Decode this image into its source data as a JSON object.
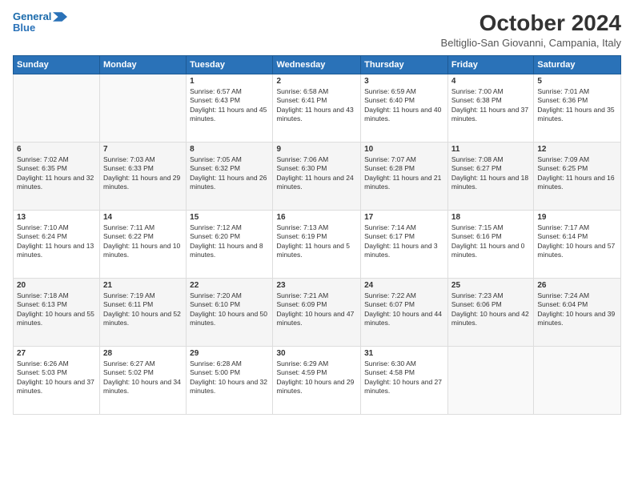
{
  "header": {
    "logo_line1": "General",
    "logo_line2": "Blue",
    "month": "October 2024",
    "location": "Beltiglio-San Giovanni, Campania, Italy"
  },
  "days_of_week": [
    "Sunday",
    "Monday",
    "Tuesday",
    "Wednesday",
    "Thursday",
    "Friday",
    "Saturday"
  ],
  "weeks": [
    [
      {
        "day": "",
        "data": ""
      },
      {
        "day": "",
        "data": ""
      },
      {
        "day": "1",
        "data": "Sunrise: 6:57 AM\nSunset: 6:43 PM\nDaylight: 11 hours and 45 minutes."
      },
      {
        "day": "2",
        "data": "Sunrise: 6:58 AM\nSunset: 6:41 PM\nDaylight: 11 hours and 43 minutes."
      },
      {
        "day": "3",
        "data": "Sunrise: 6:59 AM\nSunset: 6:40 PM\nDaylight: 11 hours and 40 minutes."
      },
      {
        "day": "4",
        "data": "Sunrise: 7:00 AM\nSunset: 6:38 PM\nDaylight: 11 hours and 37 minutes."
      },
      {
        "day": "5",
        "data": "Sunrise: 7:01 AM\nSunset: 6:36 PM\nDaylight: 11 hours and 35 minutes."
      }
    ],
    [
      {
        "day": "6",
        "data": "Sunrise: 7:02 AM\nSunset: 6:35 PM\nDaylight: 11 hours and 32 minutes."
      },
      {
        "day": "7",
        "data": "Sunrise: 7:03 AM\nSunset: 6:33 PM\nDaylight: 11 hours and 29 minutes."
      },
      {
        "day": "8",
        "data": "Sunrise: 7:05 AM\nSunset: 6:32 PM\nDaylight: 11 hours and 26 minutes."
      },
      {
        "day": "9",
        "data": "Sunrise: 7:06 AM\nSunset: 6:30 PM\nDaylight: 11 hours and 24 minutes."
      },
      {
        "day": "10",
        "data": "Sunrise: 7:07 AM\nSunset: 6:28 PM\nDaylight: 11 hours and 21 minutes."
      },
      {
        "day": "11",
        "data": "Sunrise: 7:08 AM\nSunset: 6:27 PM\nDaylight: 11 hours and 18 minutes."
      },
      {
        "day": "12",
        "data": "Sunrise: 7:09 AM\nSunset: 6:25 PM\nDaylight: 11 hours and 16 minutes."
      }
    ],
    [
      {
        "day": "13",
        "data": "Sunrise: 7:10 AM\nSunset: 6:24 PM\nDaylight: 11 hours and 13 minutes."
      },
      {
        "day": "14",
        "data": "Sunrise: 7:11 AM\nSunset: 6:22 PM\nDaylight: 11 hours and 10 minutes."
      },
      {
        "day": "15",
        "data": "Sunrise: 7:12 AM\nSunset: 6:20 PM\nDaylight: 11 hours and 8 minutes."
      },
      {
        "day": "16",
        "data": "Sunrise: 7:13 AM\nSunset: 6:19 PM\nDaylight: 11 hours and 5 minutes."
      },
      {
        "day": "17",
        "data": "Sunrise: 7:14 AM\nSunset: 6:17 PM\nDaylight: 11 hours and 3 minutes."
      },
      {
        "day": "18",
        "data": "Sunrise: 7:15 AM\nSunset: 6:16 PM\nDaylight: 11 hours and 0 minutes."
      },
      {
        "day": "19",
        "data": "Sunrise: 7:17 AM\nSunset: 6:14 PM\nDaylight: 10 hours and 57 minutes."
      }
    ],
    [
      {
        "day": "20",
        "data": "Sunrise: 7:18 AM\nSunset: 6:13 PM\nDaylight: 10 hours and 55 minutes."
      },
      {
        "day": "21",
        "data": "Sunrise: 7:19 AM\nSunset: 6:11 PM\nDaylight: 10 hours and 52 minutes."
      },
      {
        "day": "22",
        "data": "Sunrise: 7:20 AM\nSunset: 6:10 PM\nDaylight: 10 hours and 50 minutes."
      },
      {
        "day": "23",
        "data": "Sunrise: 7:21 AM\nSunset: 6:09 PM\nDaylight: 10 hours and 47 minutes."
      },
      {
        "day": "24",
        "data": "Sunrise: 7:22 AM\nSunset: 6:07 PM\nDaylight: 10 hours and 44 minutes."
      },
      {
        "day": "25",
        "data": "Sunrise: 7:23 AM\nSunset: 6:06 PM\nDaylight: 10 hours and 42 minutes."
      },
      {
        "day": "26",
        "data": "Sunrise: 7:24 AM\nSunset: 6:04 PM\nDaylight: 10 hours and 39 minutes."
      }
    ],
    [
      {
        "day": "27",
        "data": "Sunrise: 6:26 AM\nSunset: 5:03 PM\nDaylight: 10 hours and 37 minutes."
      },
      {
        "day": "28",
        "data": "Sunrise: 6:27 AM\nSunset: 5:02 PM\nDaylight: 10 hours and 34 minutes."
      },
      {
        "day": "29",
        "data": "Sunrise: 6:28 AM\nSunset: 5:00 PM\nDaylight: 10 hours and 32 minutes."
      },
      {
        "day": "30",
        "data": "Sunrise: 6:29 AM\nSunset: 4:59 PM\nDaylight: 10 hours and 29 minutes."
      },
      {
        "day": "31",
        "data": "Sunrise: 6:30 AM\nSunset: 4:58 PM\nDaylight: 10 hours and 27 minutes."
      },
      {
        "day": "",
        "data": ""
      },
      {
        "day": "",
        "data": ""
      }
    ]
  ]
}
